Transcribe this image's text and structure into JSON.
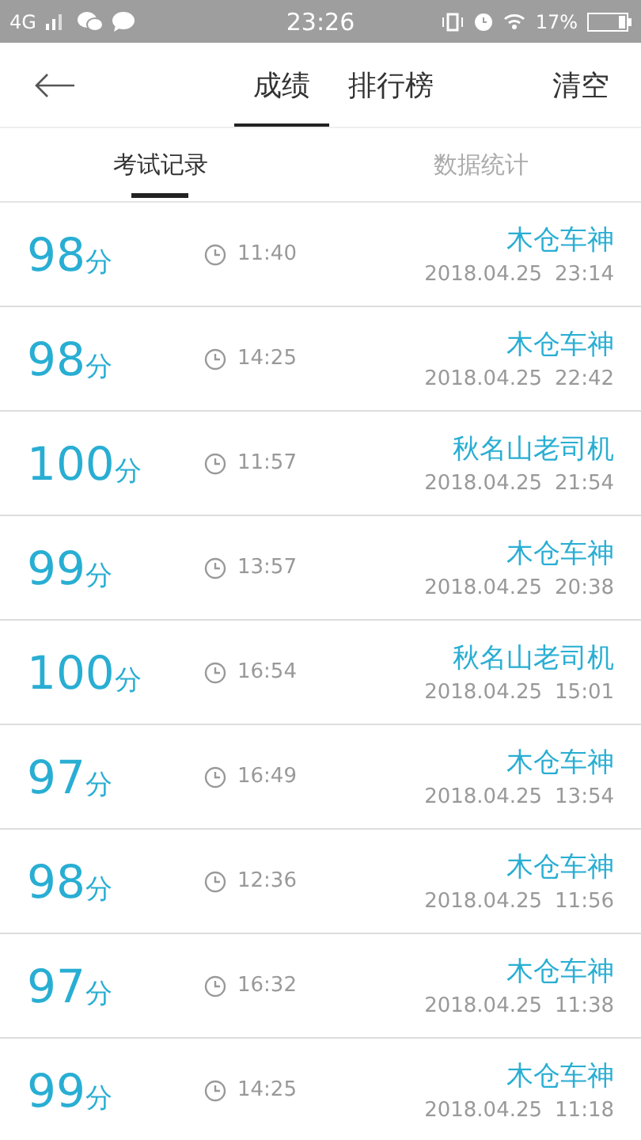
{
  "status_bar": {
    "network": "4G",
    "time": "23:26",
    "battery": "17%"
  },
  "header": {
    "tabs": [
      {
        "label": "成绩",
        "selected": true
      },
      {
        "label": "排行榜",
        "selected": false
      }
    ],
    "action": "清空"
  },
  "sub_tabs": [
    {
      "label": "考试记录",
      "selected": true
    },
    {
      "label": "数据统计",
      "selected": false
    }
  ],
  "records": [
    {
      "score": "98",
      "unit": "分",
      "duration": "11:40",
      "name": "木仓车神",
      "date": "2018.04.25",
      "time": "23:14"
    },
    {
      "score": "98",
      "unit": "分",
      "duration": "14:25",
      "name": "木仓车神",
      "date": "2018.04.25",
      "time": "22:42"
    },
    {
      "score": "100",
      "unit": "分",
      "duration": "11:57",
      "name": "秋名山老司机",
      "date": "2018.04.25",
      "time": "21:54"
    },
    {
      "score": "99",
      "unit": "分",
      "duration": "13:57",
      "name": "木仓车神",
      "date": "2018.04.25",
      "time": "20:38"
    },
    {
      "score": "100",
      "unit": "分",
      "duration": "16:54",
      "name": "秋名山老司机",
      "date": "2018.04.25",
      "time": "15:01"
    },
    {
      "score": "97",
      "unit": "分",
      "duration": "16:49",
      "name": "木仓车神",
      "date": "2018.04.25",
      "time": "13:54"
    },
    {
      "score": "98",
      "unit": "分",
      "duration": "12:36",
      "name": "木仓车神",
      "date": "2018.04.25",
      "time": "11:56"
    },
    {
      "score": "97",
      "unit": "分",
      "duration": "16:32",
      "name": "木仓车神",
      "date": "2018.04.25",
      "time": "11:38"
    },
    {
      "score": "99",
      "unit": "分",
      "duration": "14:25",
      "name": "木仓车神",
      "date": "2018.04.25",
      "time": "11:18"
    }
  ]
}
